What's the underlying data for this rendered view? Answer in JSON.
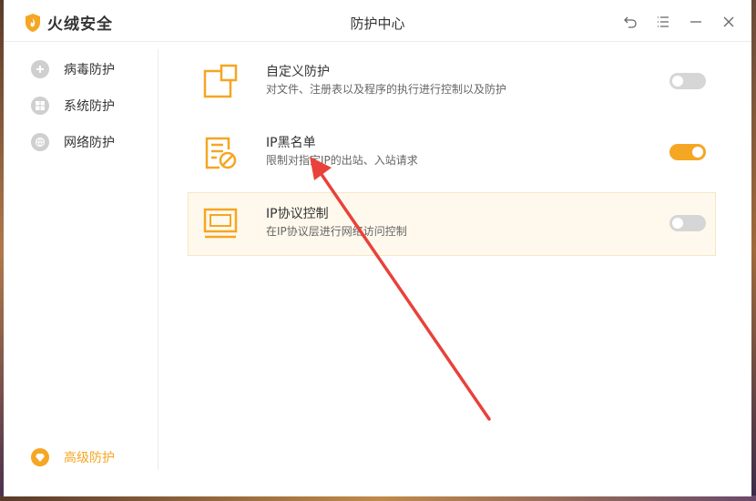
{
  "app": {
    "name": "火绒安全",
    "title": "防护中心",
    "brand_color": "#f5a623"
  },
  "window_controls": [
    {
      "icon": "back-icon"
    },
    {
      "icon": "menu-icon"
    },
    {
      "icon": "minimize-icon"
    },
    {
      "icon": "close-icon"
    }
  ],
  "sidebar": {
    "items": [
      {
        "label": "病毒防护",
        "icon": "virus-shield-icon",
        "active": false
      },
      {
        "label": "系统防护",
        "icon": "windows-icon",
        "active": false
      },
      {
        "label": "网络防护",
        "icon": "globe-icon",
        "active": false
      },
      {
        "label": "高级防护",
        "icon": "diamond-icon",
        "active": true
      }
    ]
  },
  "cards": [
    {
      "title": "自定义防护",
      "desc": "对文件、注册表以及程序的执行进行控制以及防护",
      "icon": "custom-protect-icon",
      "enabled": false
    },
    {
      "title": "IP黑名单",
      "desc": "限制对指定IP的出站、入站请求",
      "icon": "blacklist-icon",
      "enabled": true
    },
    {
      "title": "IP协议控制",
      "desc": "在IP协议层进行网络访问控制",
      "icon": "protocol-icon",
      "enabled": false
    }
  ],
  "annotation": {
    "color": "#e8423a"
  }
}
